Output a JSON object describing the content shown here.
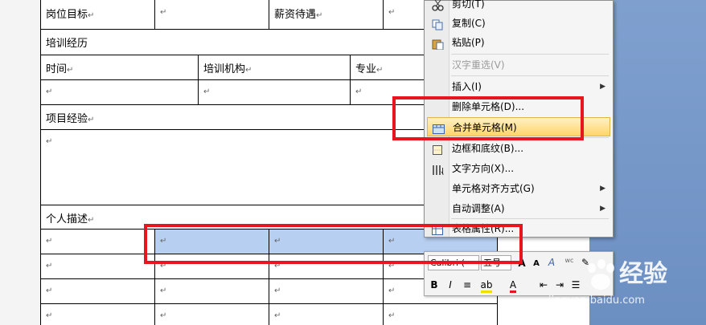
{
  "table": {
    "row_position_label": "岗位目标",
    "row_salary_label": "薪资待遇",
    "training_header": "培训经历",
    "col_time": "时间",
    "col_institution": "培训机构",
    "col_major": "专业",
    "project_header": "项目经验",
    "personal_header": "个人描述",
    "mark": "↵"
  },
  "context_menu": {
    "items": [
      {
        "label": "剪切(T)",
        "icon": "scissors-icon"
      },
      {
        "label": "复制(C)",
        "icon": "copy-icon"
      },
      {
        "label": "粘贴(P)",
        "icon": "paste-icon"
      },
      {
        "label": "汉字重选(V)",
        "disabled": true
      },
      {
        "label": "插入(I)",
        "submenu": true
      },
      {
        "label": "删除单元格(D)..."
      },
      {
        "label": "合并单元格(M)",
        "icon": "merge-cells-icon",
        "highlighted": true
      },
      {
        "label": "边框和底纹(B)...",
        "icon": "borders-icon"
      },
      {
        "label": "文字方向(X)...",
        "icon": "text-direction-icon"
      },
      {
        "label": "单元格对齐方式(G)",
        "submenu": true
      },
      {
        "label": "自动调整(A)",
        "submenu": true
      },
      {
        "label": "表格属性(R)...",
        "icon": "table-properties-icon"
      }
    ]
  },
  "mini_toolbar": {
    "font": "Calibri (",
    "size": "五号"
  },
  "watermark": {
    "brand": "经验",
    "url": "jingyan.baidu.com"
  },
  "colors": {
    "highlight": "#ffd56b",
    "annotation_red": "#e8151e",
    "selection": "#b7cff0"
  }
}
